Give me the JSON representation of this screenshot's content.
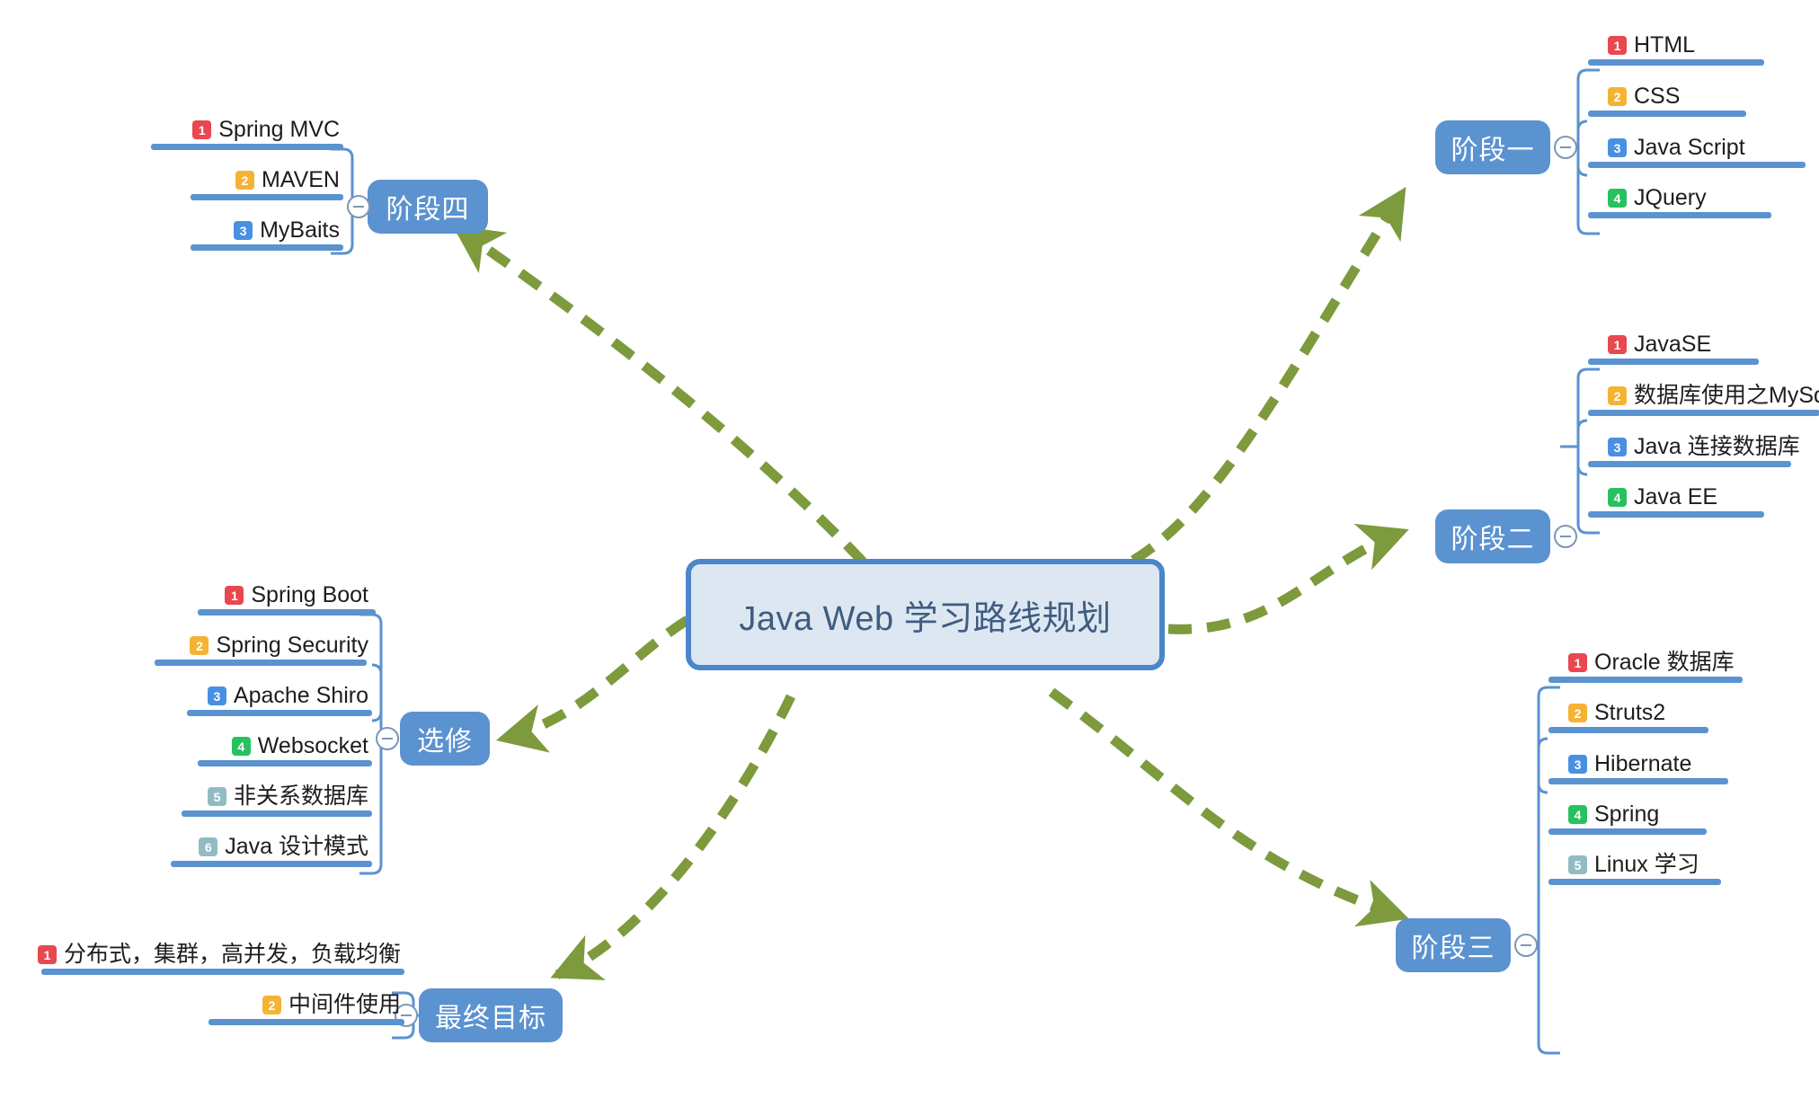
{
  "diagram": {
    "title": "Java Web 学习路线规划",
    "type": "mindmap",
    "colors": {
      "root_fill": "#dde7f2",
      "root_border": "#4a86c8",
      "root_text": "#3f5c80",
      "branch_fill": "#5b92d0",
      "branch_text": "#ffffff",
      "link_line": "#5b92d0",
      "arrow": "#7d9a3c",
      "leaf_text": "#1d1d1d",
      "badge_1": "#e8484f",
      "badge_2": "#f5b335",
      "badge_3": "#4a90e2",
      "badge_4": "#27c160",
      "badge_5": "#92bcc4",
      "badge_6": "#92bcc4"
    },
    "collapse_icon": "minus-circle-icon"
  },
  "branches": [
    {
      "id": "stage-one",
      "label": "阶段一",
      "side": "right",
      "leaves": [
        {
          "n": "1",
          "text": "HTML",
          "color": "#e8484f"
        },
        {
          "n": "2",
          "text": "CSS",
          "color": "#f5b335"
        },
        {
          "n": "3",
          "text": "Java Script",
          "color": "#4a90e2"
        },
        {
          "n": "4",
          "text": "JQuery",
          "color": "#27c160"
        }
      ]
    },
    {
      "id": "stage-two",
      "label": "阶段二",
      "side": "right",
      "leaves": [
        {
          "n": "1",
          "text": "JavaSE",
          "color": "#e8484f"
        },
        {
          "n": "2",
          "text": "数据库使用之MySql",
          "color": "#f5b335"
        },
        {
          "n": "3",
          "text": "Java 连接数据库",
          "color": "#4a90e2"
        },
        {
          "n": "4",
          "text": "Java EE",
          "color": "#27c160"
        }
      ]
    },
    {
      "id": "stage-three",
      "label": "阶段三",
      "side": "right",
      "leaves": [
        {
          "n": "1",
          "text": "Oracle 数据库",
          "color": "#e8484f"
        },
        {
          "n": "2",
          "text": "Struts2",
          "color": "#f5b335"
        },
        {
          "n": "3",
          "text": "Hibernate",
          "color": "#4a90e2"
        },
        {
          "n": "4",
          "text": "Spring",
          "color": "#27c160"
        },
        {
          "n": "5",
          "text": "Linux 学习",
          "color": "#92bcc4"
        }
      ]
    },
    {
      "id": "stage-four",
      "label": "阶段四",
      "side": "left",
      "leaves": [
        {
          "n": "1",
          "text": "Spring MVC",
          "color": "#e8484f"
        },
        {
          "n": "2",
          "text": "MAVEN",
          "color": "#f5b335"
        },
        {
          "n": "3",
          "text": "MyBaits",
          "color": "#4a90e2"
        }
      ]
    },
    {
      "id": "elective",
      "label": "选修",
      "side": "left",
      "leaves": [
        {
          "n": "1",
          "text": "Spring Boot",
          "color": "#e8484f"
        },
        {
          "n": "2",
          "text": "Spring Security",
          "color": "#f5b335"
        },
        {
          "n": "3",
          "text": "Apache Shiro",
          "color": "#4a90e2"
        },
        {
          "n": "4",
          "text": "Websocket",
          "color": "#27c160"
        },
        {
          "n": "5",
          "text": "非关系数据库",
          "color": "#92bcc4"
        },
        {
          "n": "6",
          "text": "Java 设计模式",
          "color": "#92bcc4"
        }
      ]
    },
    {
      "id": "final-goal",
      "label": "最终目标",
      "side": "left",
      "leaves": [
        {
          "n": "1",
          "text": "分布式，集群，高并发，负载均衡",
          "color": "#e8484f"
        },
        {
          "n": "2",
          "text": "中间件使用",
          "color": "#f5b335"
        }
      ]
    }
  ]
}
